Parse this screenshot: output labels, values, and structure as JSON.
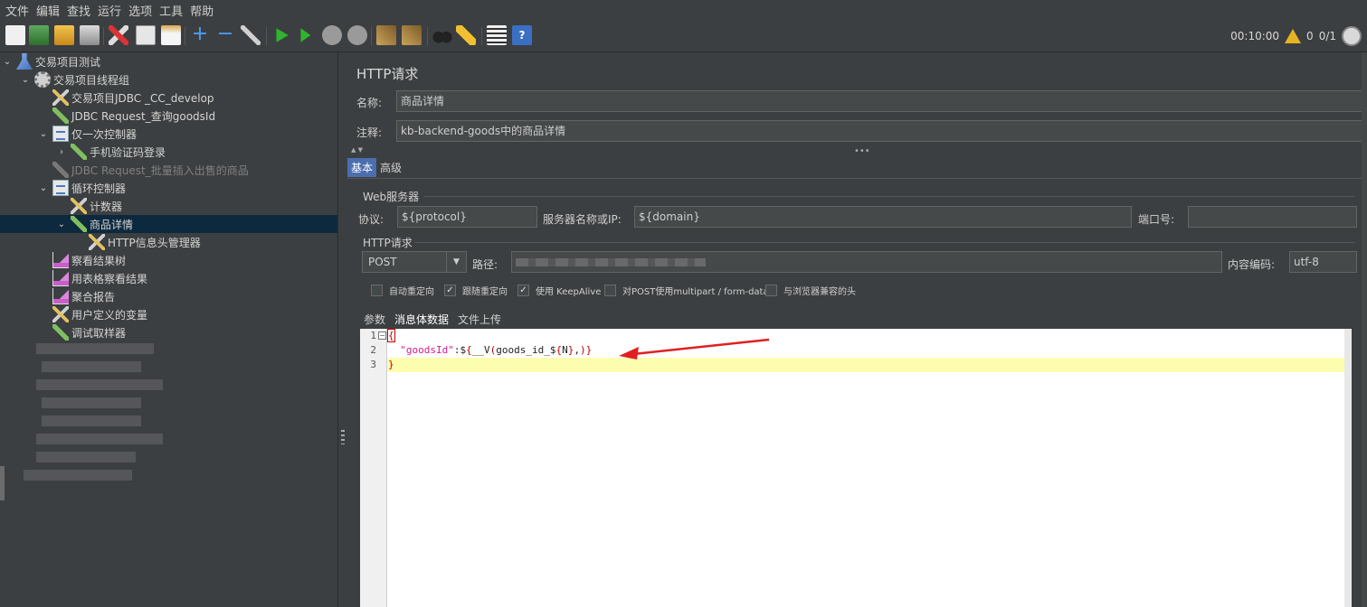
{
  "menu": [
    "文件",
    "编辑",
    "查找",
    "运行",
    "选项",
    "工具",
    "帮助"
  ],
  "toolbar": {
    "icons": [
      "new-icon",
      "templates-icon",
      "open-icon",
      "save-icon",
      "cut-icon",
      "copy-icon",
      "paste-icon",
      "expand-icon",
      "collapse-icon",
      "toggle-icon",
      "start-icon",
      "start-no-pause-icon",
      "stop-icon",
      "shutdown-icon",
      "clear-icon",
      "clear-all-icon",
      "search-icon",
      "reset-search-icon",
      "function-helper-icon",
      "help-icon"
    ],
    "timer": "00:10:00",
    "warning_count": "0",
    "thread_count": "0/1"
  },
  "tree": [
    {
      "label": "交易项目测试",
      "icon": "flask-icon",
      "indent": 0,
      "expanded": true
    },
    {
      "label": "交易项目线程组",
      "icon": "gear-icon",
      "indent": 1,
      "expanded": true
    },
    {
      "label": "交易项目JDBC _CC_develop",
      "icon": "tools-icon",
      "indent": 2
    },
    {
      "label": "JDBC Request_查询goodsId",
      "icon": "pipette-icon",
      "indent": 2
    },
    {
      "label": "仅一次控制器",
      "icon": "controller-icon",
      "indent": 2,
      "expanded": true
    },
    {
      "label": "手机验证码登录",
      "icon": "pipette-icon",
      "indent": 3,
      "collapsed": true
    },
    {
      "label": "JDBC Request_批量插入出售的商品",
      "icon": "pipette-icon",
      "indent": 2,
      "disabled": true
    },
    {
      "label": "循环控制器",
      "icon": "controller-icon",
      "indent": 2,
      "expanded": true
    },
    {
      "label": "计数器",
      "icon": "tools-icon",
      "indent": 3
    },
    {
      "label": "商品详情",
      "icon": "pipette-icon",
      "indent": 3,
      "expanded": true,
      "selected": true
    },
    {
      "label": "HTTP信息头管理器",
      "icon": "tools-icon",
      "indent": 4
    },
    {
      "label": "察看结果树",
      "icon": "chart-icon",
      "indent": 2
    },
    {
      "label": "用表格察看结果",
      "icon": "chart-icon",
      "indent": 2
    },
    {
      "label": "聚合报告",
      "icon": "chart-icon",
      "indent": 2
    },
    {
      "label": "用户定义的变量",
      "icon": "tools-icon",
      "indent": 2
    },
    {
      "label": "调试取样器",
      "icon": "pipette-icon",
      "indent": 2
    }
  ],
  "panel": {
    "title": "HTTP请求",
    "name_label": "名称:",
    "name_value": "商品详情",
    "comment_label": "注释:",
    "comment_value": "kb-backend-goods中的商品详情",
    "tabs": [
      "基本",
      "高级"
    ],
    "web_server_title": "Web服务器",
    "protocol_label": "协议:",
    "protocol_value": "${protocol}",
    "server_label": "服务器名称或IP:",
    "server_value": "${domain}",
    "port_label": "端口号:",
    "port_value": "",
    "http_request_title": "HTTP请求",
    "method_value": "POST",
    "path_label": "路径:",
    "encoding_label": "内容编码:",
    "encoding_value": "utf-8",
    "checkboxes": [
      {
        "label": "自动重定向",
        "checked": false
      },
      {
        "label": "跟随重定向",
        "checked": true
      },
      {
        "label": "使用 KeepAlive",
        "checked": true
      },
      {
        "label": "对POST使用multipart / form-data",
        "checked": false
      },
      {
        "label": "与浏览器兼容的头",
        "checked": false
      }
    ],
    "body_tabs": [
      "参数",
      "消息体数据",
      "文件上传"
    ]
  },
  "editor": {
    "line_numbers": [
      "1",
      "2",
      "3"
    ],
    "line1": "{",
    "line2_key": "\"goodsId\"",
    "line2_colon": ":",
    "line2_dollar": "$",
    "line2_brace_open": "{",
    "line2_func": "__V",
    "line2_paren_open": "(",
    "line2_arg_a": "goods_id_$",
    "line2_inner_open": "{",
    "line2_arg_n": "N",
    "line2_inner_close": "}",
    "line2_comma": ",",
    "line2_paren_close": ")",
    "line2_brace_close": "}",
    "line3": "}"
  },
  "colors": {
    "background": "#3c3f41",
    "selection": "#0d293e",
    "accent": "#4b6eaf",
    "arrow": "#e02020",
    "highlight_line": "#fdfdb0"
  }
}
